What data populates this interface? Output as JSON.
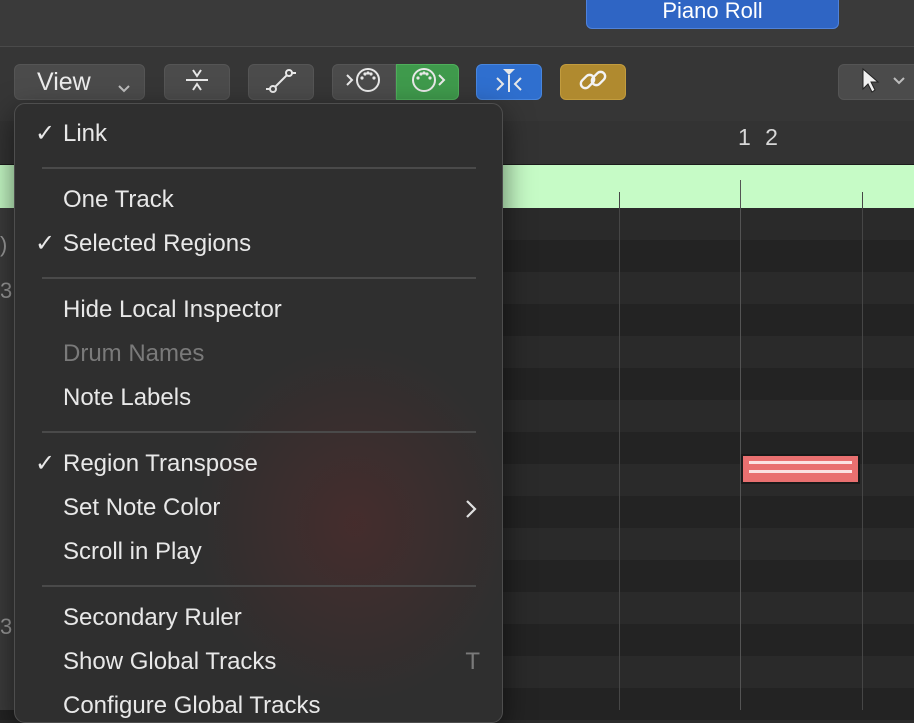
{
  "header": {
    "tab_label": "Piano Roll"
  },
  "toolbar": {
    "view_label": "View"
  },
  "ruler": {
    "label": "1 2"
  },
  "view_menu": {
    "items": [
      {
        "label": "Link",
        "checked": true
      },
      {
        "label": "One Track",
        "checked": false
      },
      {
        "label": "Selected Regions",
        "checked": true
      },
      {
        "label": "Hide Local Inspector",
        "checked": false
      },
      {
        "label": "Drum Names",
        "checked": false,
        "disabled": true
      },
      {
        "label": "Note Labels",
        "checked": false
      },
      {
        "label": "Region Transpose",
        "checked": true
      },
      {
        "label": "Set Note Color",
        "checked": false,
        "submenu": true
      },
      {
        "label": "Scroll in Play",
        "checked": false
      },
      {
        "label": "Secondary Ruler",
        "checked": false
      },
      {
        "label": "Show Global Tracks",
        "checked": false,
        "shortcut": "T"
      },
      {
        "label": "Configure Global Tracks",
        "checked": false
      }
    ],
    "check_glyph": "✓"
  },
  "left_strip": {
    "frag_1": ")",
    "frag_2": "3",
    "frag_3": "3"
  },
  "colors": {
    "tab_blue": "#2f65c4",
    "region_green": "#c6fbc6",
    "note_red": "#e97070",
    "button_green": "#3f9a4c",
    "button_blue": "#2f6fcf",
    "button_gold": "#b08a2f"
  },
  "icons": {
    "view_chevron": "chevron-down-icon",
    "compress": "vertical-zoom-icon",
    "automation": "automation-curve-icon",
    "midi_in": "midi-in-icon",
    "midi_out": "midi-out-icon",
    "catch": "catch-playhead-icon",
    "link": "link-icon",
    "pointer": "pointer-tool-icon"
  }
}
